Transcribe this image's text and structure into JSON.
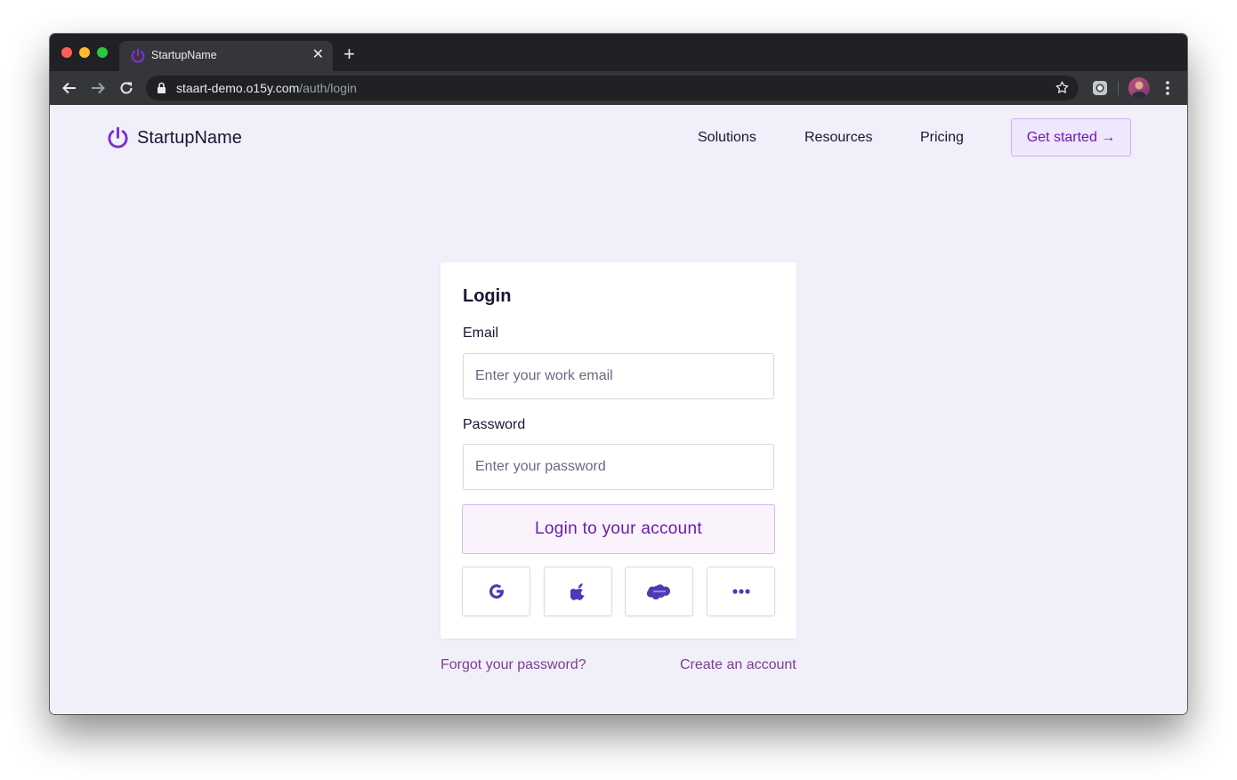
{
  "browser": {
    "tab_title": "StartupName",
    "tab_close": "✕",
    "new_tab": "+",
    "url_host": "staart-demo.o15y.com",
    "url_path": "/auth/login"
  },
  "header": {
    "brand": "StartupName",
    "nav": [
      "Solutions",
      "Resources",
      "Pricing"
    ],
    "cta": "Get started →"
  },
  "login": {
    "title": "Login",
    "email_label": "Email",
    "email_placeholder": "Enter your work email",
    "email_value": "",
    "password_label": "Password",
    "password_placeholder": "Enter your password",
    "password_value": "",
    "submit": "Login to your account",
    "social": [
      "google-icon",
      "apple-icon",
      "salesforce-icon",
      "more-icon"
    ]
  },
  "links": {
    "forgot": "Forgot your password?",
    "create": "Create an account"
  },
  "colors": {
    "accent": "#6a1bb3",
    "page_bg": "#f1f0fa",
    "social_icon": "#4b3bb8"
  }
}
